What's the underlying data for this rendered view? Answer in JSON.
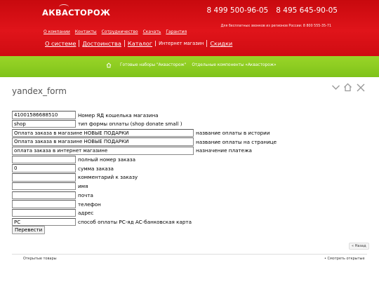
{
  "header": {
    "logo": "АКВАСТОРОЖ",
    "phones": [
      "8 499 500-96-05",
      "8 495 645-90-05"
    ],
    "free_call": "Для бесплатных звонков из регионов России: 8 800 555-35-71",
    "topnav": [
      "О компании",
      "Контакты",
      "Сотрудничество",
      "Скачать",
      "Гарантия"
    ],
    "mainnav": [
      {
        "label": "О системе",
        "active": false
      },
      {
        "label": "Достоинства",
        "active": false
      },
      {
        "label": "Каталог",
        "active": false
      },
      {
        "label": "Интернет магазин",
        "active": true
      },
      {
        "label": "Скидки",
        "active": false
      }
    ]
  },
  "breadcrumbs": [
    "Готовые наборы \"Аквасторож\"",
    "Отдельные компоненты «Аквасторож»"
  ],
  "page_title": "yandex_form",
  "form": {
    "rows": [
      {
        "value": "410015866885​10",
        "label": "Номер ЯД кошелька магазина",
        "wide": false
      },
      {
        "value": "shop",
        "label": "тип формы оплаты (shop donate small )",
        "wide": false
      },
      {
        "value": "Оплата заказа в магазине НОВЫЕ ПОДАРКИ",
        "label": "название оплаты в истории",
        "wide": true
      },
      {
        "value": "Оплата заказа в магазине НОВЫЕ ПОДАРКИ",
        "label": "название оплаты на странице",
        "wide": true
      },
      {
        "value": "оплата заказа в интернет магазине",
        "label": "назначение платежа",
        "wide": true
      },
      {
        "value": "",
        "label": "полный номер заказа",
        "wide": false
      },
      {
        "value": "0",
        "label": "сумма заказа",
        "wide": false
      },
      {
        "value": "",
        "label": "комментарий к заказу",
        "wide": false
      },
      {
        "value": "",
        "label": "имя",
        "wide": false
      },
      {
        "value": "",
        "label": "почта",
        "wide": false
      },
      {
        "value": "",
        "label": "телефон",
        "wide": false
      },
      {
        "value": "",
        "label": "адрес",
        "wide": false
      },
      {
        "value": "PC",
        "label": "способ оплаты PC-яд AC-банковская карта",
        "wide": false
      }
    ],
    "submit_label": "Перевести"
  },
  "back_label": "« Назад",
  "footer": {
    "left": "Открытые товары",
    "right": "• Смотреть открытые"
  },
  "colors": {
    "header_red": "#d50f15",
    "green_bar": "#8bcb21"
  }
}
